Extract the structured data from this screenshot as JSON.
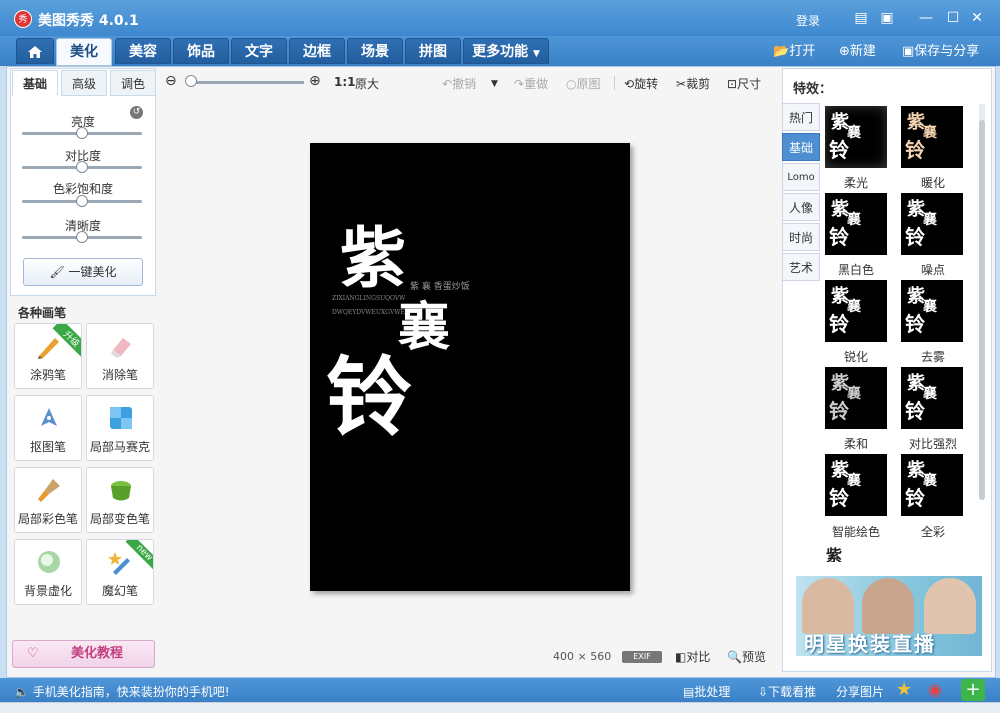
{
  "app": {
    "title": "美图秀秀 4.0.1",
    "logo_char": "秀"
  },
  "titlebar": {
    "login": "登录"
  },
  "tabs": [
    {
      "label": "美化"
    },
    {
      "label": "美容"
    },
    {
      "label": "饰品"
    },
    {
      "label": "文字"
    },
    {
      "label": "边框"
    },
    {
      "label": "场景"
    },
    {
      "label": "拼图"
    },
    {
      "label": "更多功能"
    }
  ],
  "file_actions": {
    "open": "打开",
    "new": "新建",
    "save_share": "保存与分享"
  },
  "adjust": {
    "tabs": [
      "基础",
      "高级",
      "调色"
    ],
    "sliders": [
      {
        "label": "亮度",
        "value": 0.5
      },
      {
        "label": "对比度",
        "value": 0.5
      },
      {
        "label": "色彩饱和度",
        "value": 0.5
      },
      {
        "label": "清晰度",
        "value": 0.5
      }
    ],
    "auto_button": "一键美化"
  },
  "brushes": {
    "title": "各种画笔",
    "items": [
      {
        "label": "涂鸦笔",
        "badge": "升级"
      },
      {
        "label": "消除笔"
      },
      {
        "label": "抠图笔"
      },
      {
        "label": "局部马赛克"
      },
      {
        "label": "局部彩色笔"
      },
      {
        "label": "局部变色笔"
      },
      {
        "label": "背景虚化"
      },
      {
        "label": "魔幻笔",
        "badge": "new"
      }
    ],
    "tutorial_button": "美化教程"
  },
  "toolbar": {
    "zoom_ratio": "1:1",
    "original_size": "原大",
    "undo": "撤销",
    "redo": "重做",
    "original": "原图",
    "rotate": "旋转",
    "crop": "裁剪",
    "resize": "尺寸"
  },
  "image": {
    "char1": "紫",
    "char2": "襄",
    "char3": "铃",
    "caption": "紫 襄 香蛋炒饭",
    "pinyin1": "ZIXIANGLINGSUQOVW",
    "pinyin2": "DWQEYDVWEUXGVWE"
  },
  "canvas_footer": {
    "width": "400",
    "times": "×",
    "height": "560",
    "exif": "EXIF",
    "compare": "对比",
    "preview": "预览"
  },
  "effects": {
    "title": "特效：",
    "categories": [
      "热门",
      "基础",
      "Lomo",
      "人像",
      "时尚",
      "艺术"
    ],
    "items": [
      "柔光",
      "暖化",
      "黑白色",
      "噪点",
      "锐化",
      "去雾",
      "柔和",
      "对比强烈",
      "智能绘色",
      "全彩"
    ]
  },
  "ad": {
    "text": "明星换装直播"
  },
  "statusbar": {
    "message": "手机美化指南，快来装扮你的手机吧!",
    "batch": "批处理",
    "download": "下载看推",
    "share": "分享图片"
  }
}
